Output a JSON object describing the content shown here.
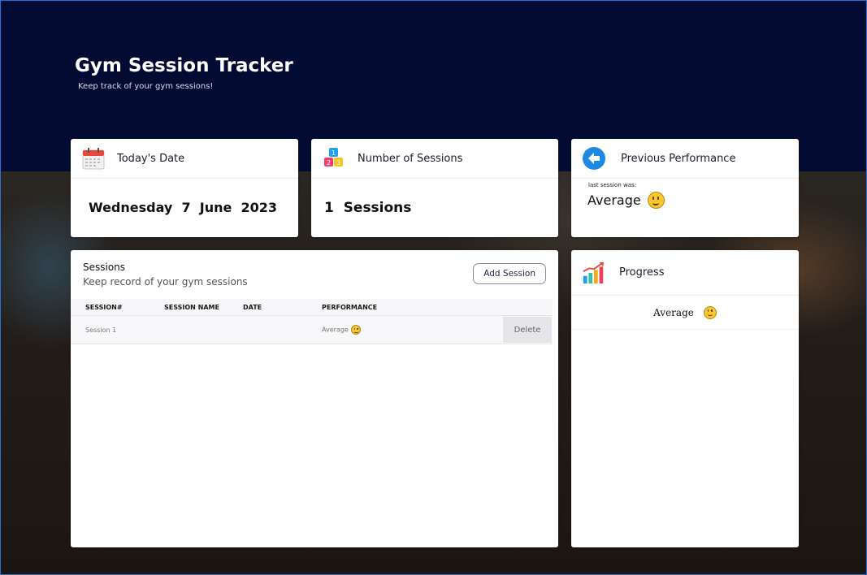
{
  "header": {
    "title": "Gym Session Tracker",
    "subtitle": "Keep track of your gym sessions!"
  },
  "cards": {
    "date": {
      "title": "Today's Date",
      "value": "Wednesday  7  June  2023",
      "icon": "calendar-icon"
    },
    "count": {
      "title": "Number of Sessions",
      "value": "1  Sessions",
      "icon": "numbered-blocks-icon"
    },
    "previous": {
      "title": "Previous Performance",
      "caption": "last session was:",
      "value": "Average",
      "icon": "back-arrow-icon"
    }
  },
  "sessions_panel": {
    "title": "Sessions",
    "subtitle": "Keep record of your gym sessions",
    "add_button": "Add Session",
    "columns": [
      "SESSION#",
      "SESSION NAME",
      "DATE",
      "PERFORMANCE"
    ],
    "rows": [
      {
        "session": "Session 1",
        "name": "",
        "date": "",
        "performance": "Average",
        "delete": "Delete"
      }
    ]
  },
  "progress_panel": {
    "title": "Progress",
    "icon": "bar-chart-icon",
    "value": "Average"
  },
  "colors": {
    "hero": "#040b32",
    "accent": "#1ea0f0"
  }
}
